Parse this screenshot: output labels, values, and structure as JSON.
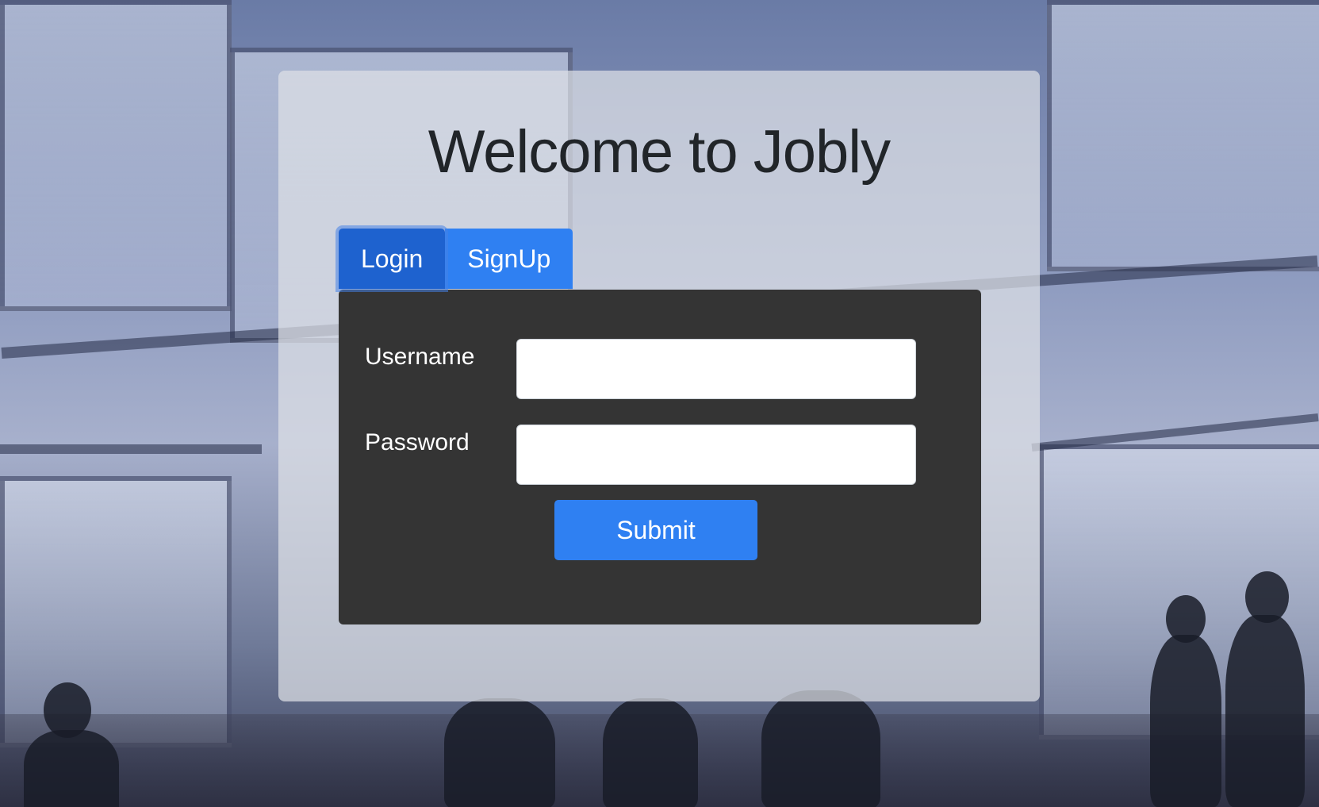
{
  "page": {
    "title": "Welcome to Jobly"
  },
  "tabs": {
    "login_label": "Login",
    "signup_label": "SignUp",
    "active": "Login"
  },
  "form": {
    "username_label": "Username",
    "username_value": "",
    "password_label": "Password",
    "password_value": "",
    "submit_label": "Submit"
  },
  "colors": {
    "accent": "#2f80f2",
    "accent_active": "#1e62cf",
    "form_background": "#343434",
    "title_text": "#212529"
  }
}
